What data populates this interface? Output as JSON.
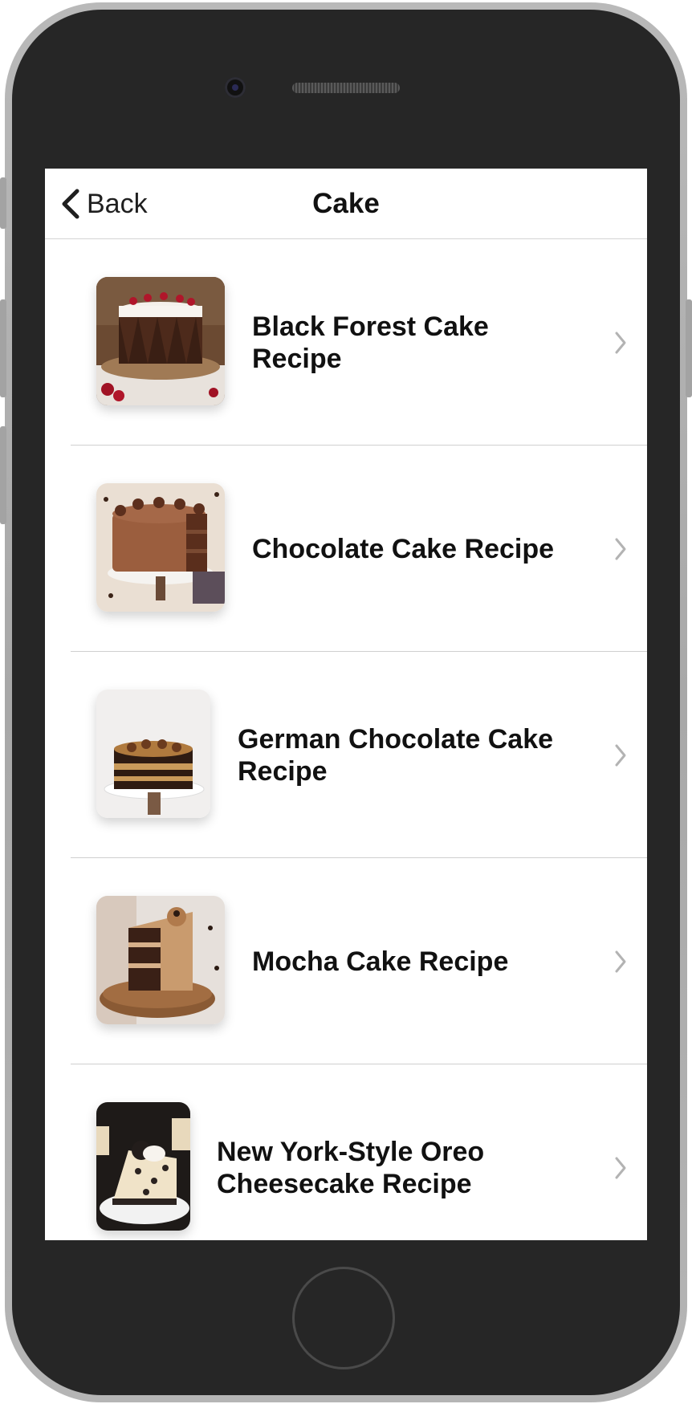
{
  "navbar": {
    "back_label": "Back",
    "back_icon": "chevron-left-icon",
    "title": "Cake"
  },
  "recipes": [
    {
      "title": "Black Forest Cake Recipe",
      "image": "black-forest-cake-photo"
    },
    {
      "title": "Chocolate Cake Recipe",
      "image": "chocolate-cake-photo"
    },
    {
      "title": "German Chocolate Cake Recipe",
      "image": "german-chocolate-cake-photo"
    },
    {
      "title": "Mocha Cake Recipe",
      "image": "mocha-cake-photo"
    },
    {
      "title": "New York-Style Oreo Cheesecake Recipe",
      "image": "oreo-cheesecake-photo"
    }
  ],
  "row_icon": "chevron-right-icon",
  "colors": {
    "device_frame": "#262626",
    "device_bezel": "#b0b0b0",
    "text": "#111111",
    "divider": "#cfcfcf",
    "chevron": "#b3b3b3"
  }
}
